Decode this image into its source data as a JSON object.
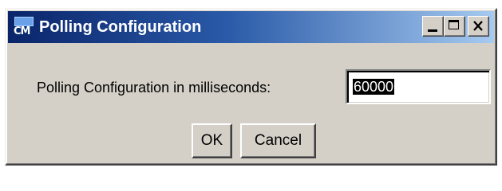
{
  "window": {
    "title": "Polling Configuration",
    "icon": "app-cm-icon",
    "icon_text": "CM",
    "caption_buttons": [
      "minimize-icon",
      "maximize-icon",
      "close-icon"
    ]
  },
  "form": {
    "label": "Polling Configuration in milliseconds:",
    "value": "60000"
  },
  "buttons": {
    "ok_label": "OK",
    "cancel_label": "Cancel"
  },
  "colors": {
    "titlebar_start": "#0a246a",
    "titlebar_end": "#a6caf0",
    "face": "#d4d0c8"
  }
}
